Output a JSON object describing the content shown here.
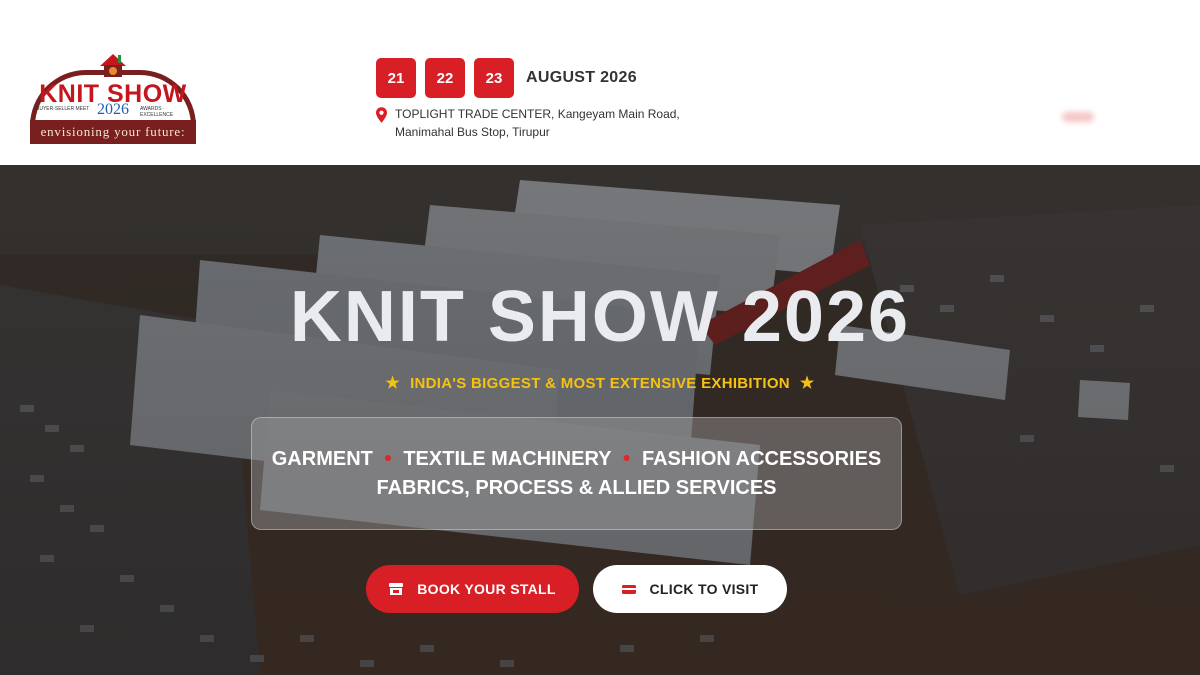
{
  "header": {
    "logo": {
      "title": "KNIT SHOW",
      "year": "2026",
      "tagline": "envisioning your future:",
      "small_left": "BUYER-SELLER MEET",
      "small_right": "AWARDS · EXCELLENCE"
    },
    "dates": [
      "21",
      "22",
      "23"
    ],
    "month": "AUGUST 2026",
    "venue_line1": "TOPLIGHT TRADE CENTER, Kangeyam Main Road,",
    "venue_line2": "Manimahal Bus Stop, Tirupur"
  },
  "hero": {
    "title": "KNIT SHOW 2026",
    "tagline": "INDIA'S BIGGEST & MOST EXTENSIVE EXHIBITION",
    "categories": {
      "item1": "GARMENT",
      "item2": "TEXTILE MACHINERY",
      "item3": "FASHION ACCESSORIES",
      "line2": "FABRICS, PROCESS & ALLIED SERVICES"
    },
    "buttons": {
      "book": "BOOK YOUR STALL",
      "visit": "CLICK TO VISIT"
    }
  },
  "colors": {
    "accent_red": "#d81f26",
    "tagline_yellow": "#f5c211",
    "logo_maroon": "#7a1f1f",
    "logo_blue": "#1f5fae"
  },
  "icons": {
    "location": "map-pin-icon",
    "star": "star-icon",
    "book": "store-icon",
    "visit": "ticket-icon"
  }
}
